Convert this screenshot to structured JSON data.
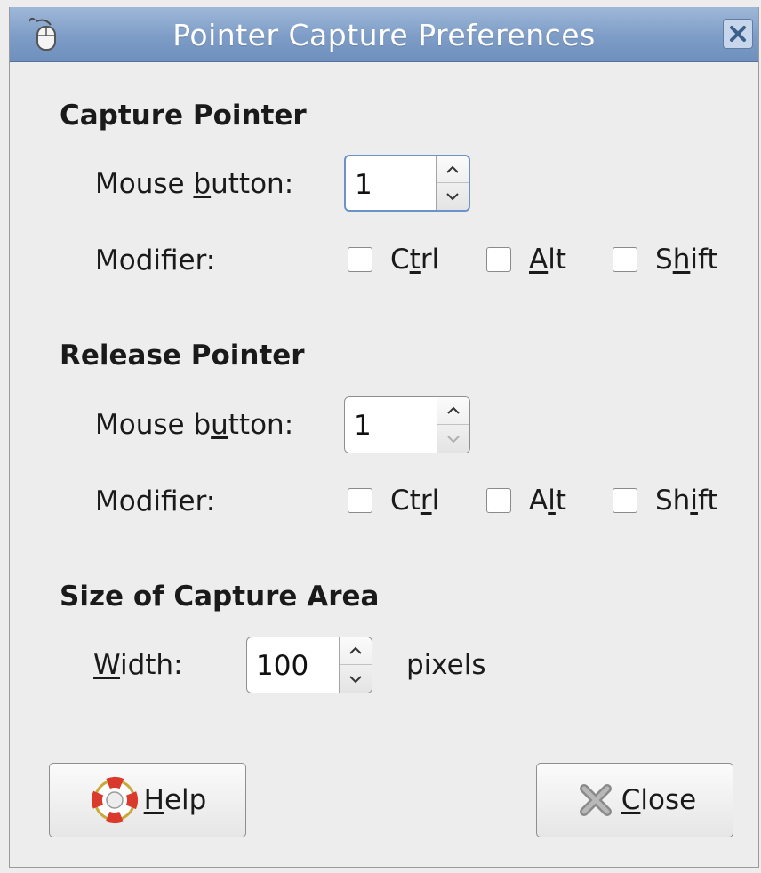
{
  "window": {
    "title": "Pointer Capture Preferences"
  },
  "capture": {
    "heading": "Capture Pointer",
    "mouse_label_pre": "Mouse ",
    "mouse_label_mn": "b",
    "mouse_label_post": "utton:",
    "mouse_value": "1",
    "modifier_label": "Modifier:",
    "ctrl": {
      "pre": "C",
      "mn": "t",
      "post": "rl",
      "checked": false
    },
    "alt": {
      "pre": "",
      "mn": "A",
      "post": "lt",
      "checked": false
    },
    "shift": {
      "pre": "S",
      "mn": "h",
      "post": "ift",
      "checked": false
    }
  },
  "release": {
    "heading": "Release Pointer",
    "mouse_label_pre": "Mouse b",
    "mouse_label_mn": "u",
    "mouse_label_post": "tton:",
    "mouse_value": "1",
    "modifier_label": "Modifier:",
    "ctrl": {
      "pre": "Ct",
      "mn": "r",
      "post": "l",
      "checked": false
    },
    "alt": {
      "pre": "A",
      "mn": "l",
      "post": "t",
      "checked": false
    },
    "shift": {
      "pre": "Sh",
      "mn": "i",
      "post": "ft",
      "checked": false
    }
  },
  "area": {
    "heading": "Size of Capture Area",
    "width_label_mn": "W",
    "width_label_post": "idth:",
    "width_value": "100",
    "unit": "pixels"
  },
  "buttons": {
    "help_mn": "H",
    "help_post": "elp",
    "close_mn": "C",
    "close_post": "lose"
  },
  "icons": {
    "title": "mouse-icon",
    "window_close": "close-x-icon",
    "help": "lifebuoy-icon",
    "close": "close-x-icon"
  },
  "colors": {
    "titlebar": "#7d9cc6",
    "focus_ring": "#6c93c9",
    "background": "#ededed"
  }
}
